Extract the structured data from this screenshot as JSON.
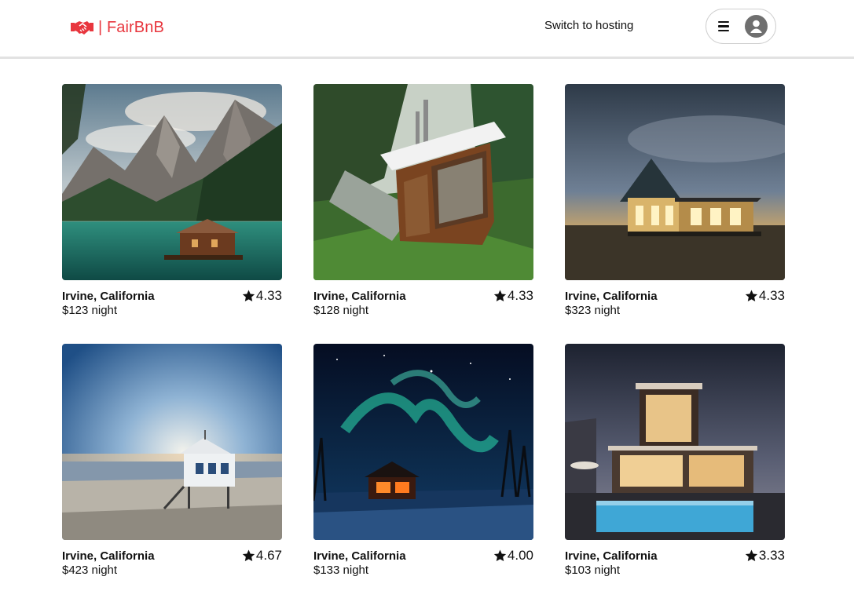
{
  "header": {
    "brand": "| FairBnB",
    "logo_icon": "handshake-icon",
    "switch_hosting_label": "Switch to hosting",
    "menu_icon": "hamburger-menu-icon",
    "avatar_icon": "user-avatar-icon"
  },
  "colors": {
    "brand": "#e8363e",
    "text": "#111111",
    "header_border": "#e2e2e2"
  },
  "listings": [
    {
      "location": "Irvine, California",
      "rating": "4.33",
      "price": "$123 night",
      "photo": "mountain lake cabin"
    },
    {
      "location": "Irvine, California",
      "rating": "4.33",
      "price": "$128 night",
      "photo": "modern forest treehouse"
    },
    {
      "location": "Irvine, California",
      "rating": "4.33",
      "price": "$323 night",
      "photo": "beach house at dusk"
    },
    {
      "location": "Irvine, California",
      "rating": "4.67",
      "price": "$423 night",
      "photo": "stilt hut on beach"
    },
    {
      "location": "Irvine, California",
      "rating": "4.00",
      "price": "$133 night",
      "photo": "cabin under aurora"
    },
    {
      "location": "Irvine, California",
      "rating": "3.33",
      "price": "$103 night",
      "photo": "modern villa with pool"
    }
  ]
}
